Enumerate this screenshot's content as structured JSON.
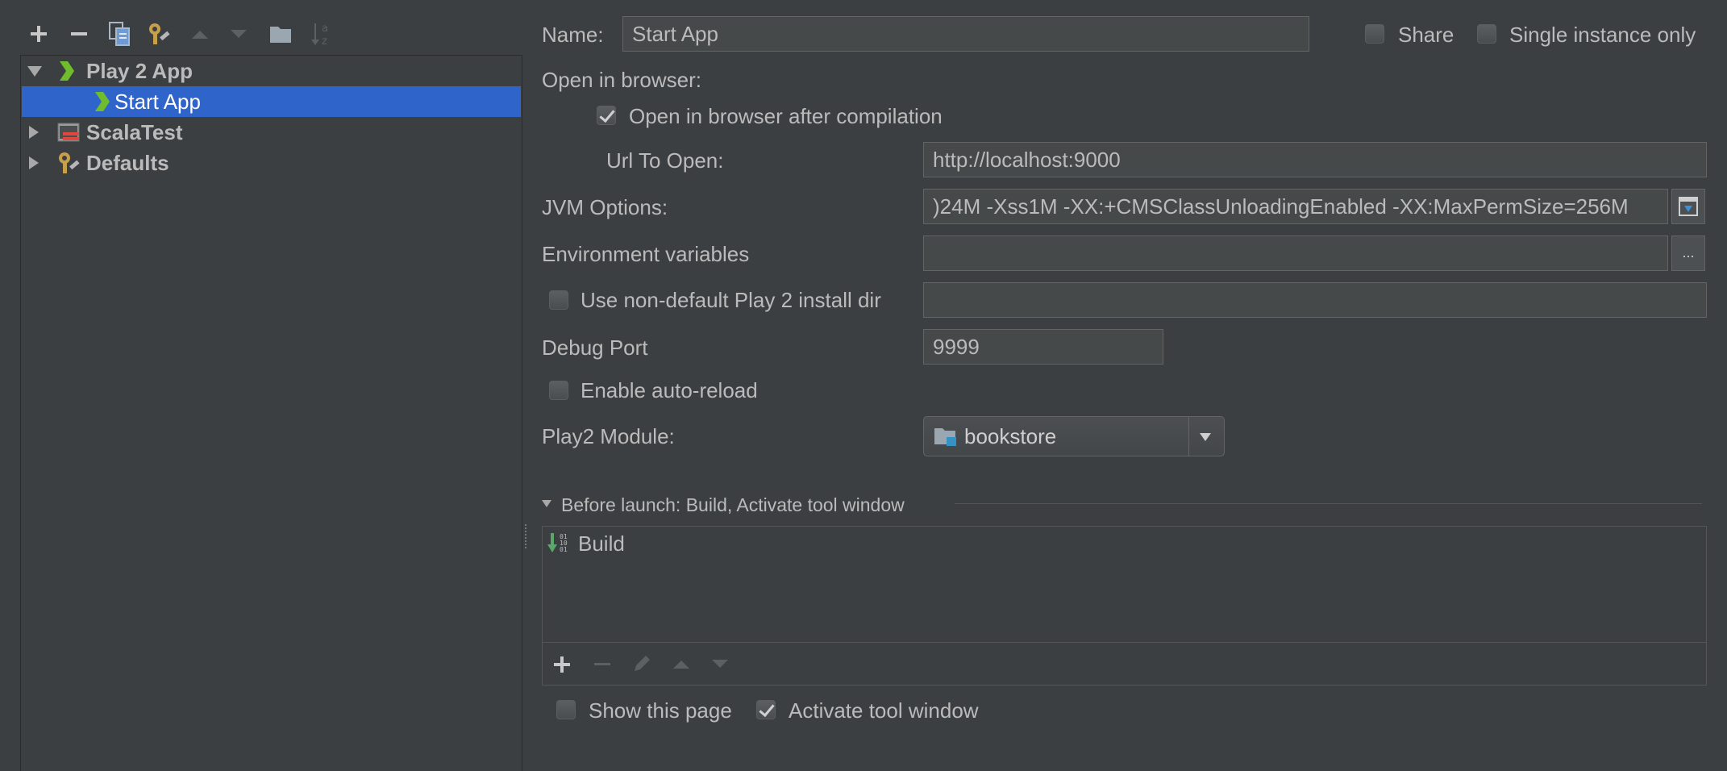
{
  "toolbar": {
    "items": [
      {
        "name": "add-icon",
        "enabled": true
      },
      {
        "name": "remove-icon",
        "enabled": true
      },
      {
        "name": "copy-icon",
        "enabled": true
      },
      {
        "name": "wrench-icon",
        "enabled": true
      },
      {
        "name": "move-up-icon",
        "enabled": false
      },
      {
        "name": "move-down-icon",
        "enabled": false
      },
      {
        "name": "folder-icon",
        "enabled": true
      },
      {
        "name": "sort-icon",
        "enabled": false
      }
    ]
  },
  "tree": {
    "items": [
      {
        "label": "Play 2 App",
        "icon": "play-chevron-icon",
        "expanded": true,
        "level": 0
      },
      {
        "label": "Start App",
        "icon": "play-chevron-icon",
        "selected": true,
        "level": 1
      },
      {
        "label": "ScalaTest",
        "icon": "scalatest-icon",
        "expanded": false,
        "level": 0
      },
      {
        "label": "Defaults",
        "icon": "wrench-icon",
        "expanded": false,
        "level": 0
      }
    ]
  },
  "form": {
    "name_label": "Name:",
    "name_value": "Start App",
    "share_label": "Share",
    "share_checked": false,
    "single_instance_label": "Single instance only",
    "single_instance_checked": false,
    "open_browser_section": "Open in browser:",
    "open_after_compile_label": "Open in browser after compilation",
    "open_after_compile_checked": true,
    "url_label": "Url To Open:",
    "url_value": "http://localhost:9000",
    "jvm_label": "JVM Options:",
    "jvm_value": ")24M -Xss1M -XX:+CMSClassUnloadingEnabled -XX:MaxPermSize=256M",
    "env_label": "Environment variables",
    "env_value": "",
    "env_button": "...",
    "nondefault_label": "Use non-default Play 2 install dir",
    "nondefault_checked": false,
    "nondefault_value": "",
    "debug_port_label": "Debug Port",
    "debug_port_value": "9999",
    "auto_reload_label": "Enable auto-reload",
    "auto_reload_checked": false,
    "module_label": "Play2 Module:",
    "module_value": "bookstore"
  },
  "before_launch": {
    "title": "Before launch: Build, Activate tool window",
    "items": [
      {
        "label": "Build",
        "icon": "build-icon"
      }
    ],
    "toolbar": [
      "add-icon",
      "remove-icon",
      "edit-icon",
      "move-up-icon",
      "move-down-icon"
    ],
    "show_page_label": "Show this page",
    "show_page_checked": false,
    "activate_label": "Activate tool window",
    "activate_checked": true
  },
  "colors": {
    "background": "#3c3f41",
    "field": "#45494a",
    "selection": "#2f65ca",
    "text": "#bbbbbb",
    "play_green": "#6fbd2c"
  }
}
